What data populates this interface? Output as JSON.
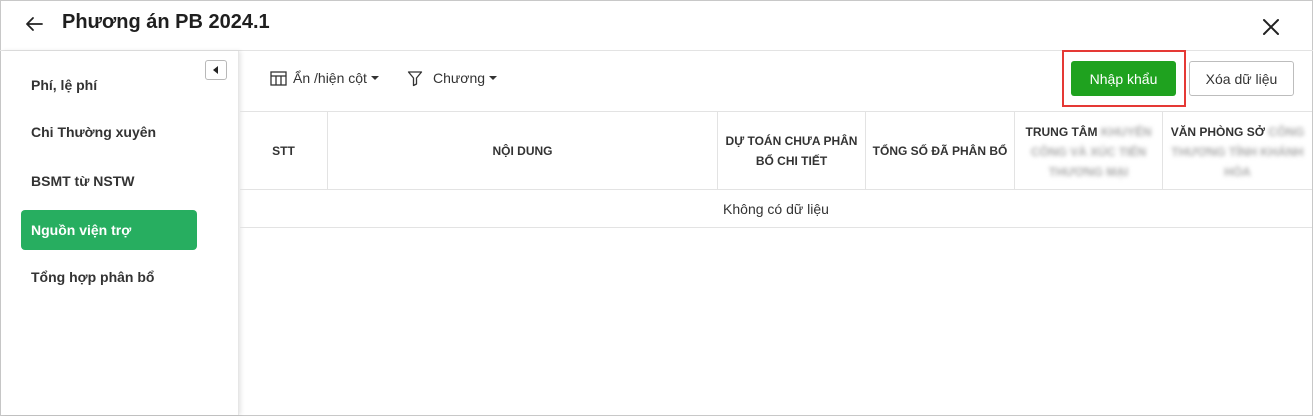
{
  "header": {
    "title": "Phương án PB 2024.1"
  },
  "sidebar": {
    "items": [
      {
        "label": "Phí, lệ phí",
        "active": false
      },
      {
        "label": "Chi Thường xuyên",
        "active": false
      },
      {
        "label": "BSMT từ NSTW",
        "active": false
      },
      {
        "label": "Nguồn viện trợ",
        "active": true
      },
      {
        "label": "Tổng hợp phân bổ",
        "active": false
      }
    ]
  },
  "toolbar": {
    "columns_toggle_label": "Ẩn /hiện cột",
    "filter_label": "Chương",
    "import_label": "Nhập khẩu",
    "clear_label": "Xóa dữ liệu"
  },
  "table": {
    "headers": {
      "stt": "STT",
      "content": "NỘI DUNG",
      "unallocated": "DỰ TOÁN CHƯA PHÂN BỔ CHI TIẾT",
      "allocated_total": "TỔNG SỐ ĐÃ PHÂN BỔ",
      "center_prefix": "TRUNG TÂM",
      "center_blurred": "KHUYẾN CÔNG VÀ XÚC TIẾN THƯƠNG MẠI",
      "office_prefix": "VĂN PHÒNG SỞ",
      "office_blurred": "CÔNG THƯƠNG TỈNH KHÁNH HÒA"
    },
    "empty_text": "Không có dữ liệu"
  },
  "colors": {
    "active_tab": "#27ae60",
    "import_button": "#1fa21f",
    "highlight": "#e53935"
  }
}
